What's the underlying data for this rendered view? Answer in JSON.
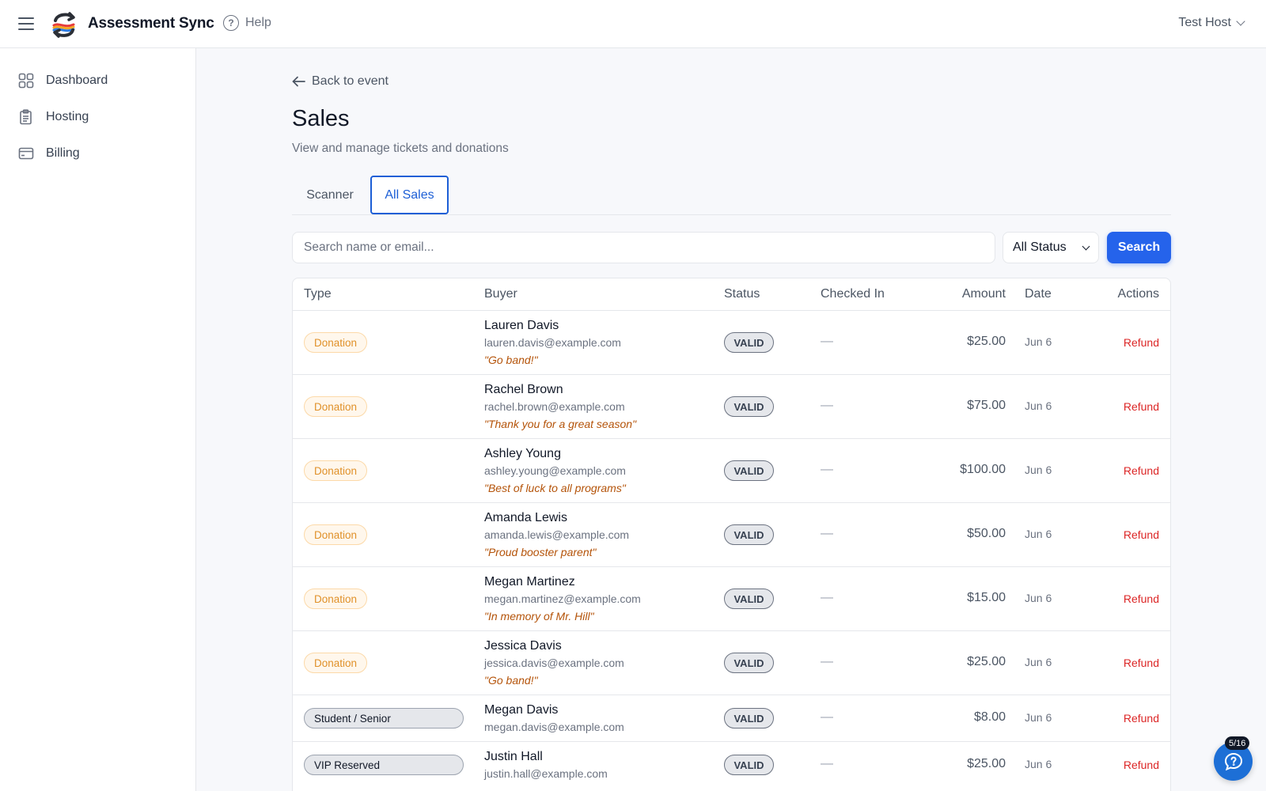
{
  "app": {
    "brand": "Assessment Sync",
    "help_label": "Help",
    "user_name": "Test Host"
  },
  "sidebar": {
    "items": [
      {
        "label": "Dashboard",
        "icon": "grid-icon"
      },
      {
        "label": "Hosting",
        "icon": "clipboard-icon"
      },
      {
        "label": "Billing",
        "icon": "credit-card-icon"
      }
    ]
  },
  "page": {
    "back_label": "Back to event",
    "title": "Sales",
    "subtitle": "View and manage tickets and donations",
    "tabs": [
      {
        "label": "Scanner",
        "active": false
      },
      {
        "label": "All Sales",
        "active": true
      }
    ]
  },
  "filters": {
    "search_placeholder": "Search name or email...",
    "search_value": "",
    "status_selected": "All Status",
    "search_button": "Search"
  },
  "table": {
    "columns": [
      "Type",
      "Buyer",
      "Status",
      "Checked In",
      "Amount",
      "Date",
      "Actions"
    ],
    "rows": [
      {
        "type": "Donation",
        "kind": "donation",
        "name": "Lauren Davis",
        "email": "lauren.davis@example.com",
        "note": "\"Go band!\"",
        "status": "VALID",
        "checked_in": "—",
        "amount": "$25.00",
        "date": "Jun 6",
        "action": "Refund"
      },
      {
        "type": "Donation",
        "kind": "donation",
        "name": "Rachel Brown",
        "email": "rachel.brown@example.com",
        "note": "\"Thank you for a great season\"",
        "status": "VALID",
        "checked_in": "—",
        "amount": "$75.00",
        "date": "Jun 6",
        "action": "Refund"
      },
      {
        "type": "Donation",
        "kind": "donation",
        "name": "Ashley Young",
        "email": "ashley.young@example.com",
        "note": "\"Best of luck to all programs\"",
        "status": "VALID",
        "checked_in": "—",
        "amount": "$100.00",
        "date": "Jun 6",
        "action": "Refund"
      },
      {
        "type": "Donation",
        "kind": "donation",
        "name": "Amanda Lewis",
        "email": "amanda.lewis@example.com",
        "note": "\"Proud booster parent\"",
        "status": "VALID",
        "checked_in": "—",
        "amount": "$50.00",
        "date": "Jun 6",
        "action": "Refund"
      },
      {
        "type": "Donation",
        "kind": "donation",
        "name": "Megan Martinez",
        "email": "megan.martinez@example.com",
        "note": "\"In memory of Mr. Hill\"",
        "status": "VALID",
        "checked_in": "—",
        "amount": "$15.00",
        "date": "Jun 6",
        "action": "Refund"
      },
      {
        "type": "Donation",
        "kind": "donation",
        "name": "Jessica Davis",
        "email": "jessica.davis@example.com",
        "note": "\"Go band!\"",
        "status": "VALID",
        "checked_in": "—",
        "amount": "$25.00",
        "date": "Jun 6",
        "action": "Refund"
      },
      {
        "type": "Student / Senior",
        "kind": "ticket",
        "name": "Megan Davis",
        "email": "megan.davis@example.com",
        "note": "",
        "status": "VALID",
        "checked_in": "—",
        "amount": "$8.00",
        "date": "Jun 6",
        "action": "Refund"
      },
      {
        "type": "VIP Reserved",
        "kind": "ticket",
        "name": "Justin Hall",
        "email": "justin.hall@example.com",
        "note": "",
        "status": "VALID",
        "checked_in": "—",
        "amount": "$25.00",
        "date": "Jun 6",
        "action": "Refund"
      }
    ]
  },
  "support": {
    "badge": "5/16",
    "icon": "chat-help-icon"
  },
  "colors": {
    "accent": "#2563eb",
    "donation": "#e0912a",
    "refund": "#dc2626",
    "note": "#b45309"
  }
}
